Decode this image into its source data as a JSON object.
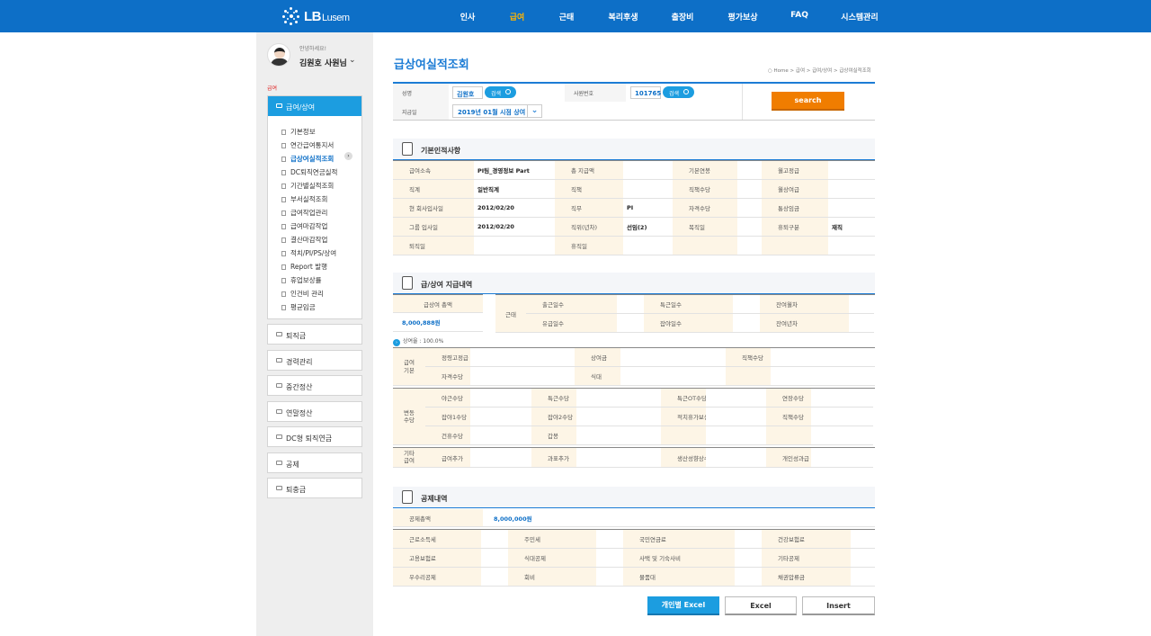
{
  "header": {
    "logo_text": "LB",
    "logo_text_small": "Lusem",
    "nav": [
      "인사",
      "급여",
      "근태",
      "복리후생",
      "출장비",
      "평가보상",
      "FAQ",
      "시스템관리"
    ],
    "nav_active": 1
  },
  "sidebar": {
    "greeting": "안녕하세요!",
    "user": "김원호 사원님",
    "section": "급여",
    "open_menu": "급여/상여",
    "submenu": [
      "기본정보",
      "연간급여통지서",
      "급상여실적조회",
      "DC퇴직연금실적",
      "기간별실적조회",
      "부서실적조회",
      "급여작업관리",
      "급여마감작업",
      "결산마감작업",
      "적치/PI/PS/상여",
      "Report 발행",
      "휴업보상률",
      "인건비 관리",
      "평균임금"
    ],
    "submenu_active": 2,
    "closed_menus": [
      "퇴직금",
      "경력관리",
      "중간정산",
      "연말정산",
      "DC형 퇴직연금",
      "공제",
      "퇴충금"
    ]
  },
  "page": {
    "title": "급상여실적조회",
    "breadcrumb": "○ Home > 급여 > 급여/상여 > 급상여실적조회"
  },
  "search": {
    "name_label": "성명",
    "name_value": "김원호",
    "name_btn": "검색",
    "empno_label": "사원번호",
    "empno_value": "101765",
    "empno_btn": "검색",
    "paydate_label": "지급일",
    "paydate_value": "2019년 01월 시점 상여",
    "search_btn": "search"
  },
  "basic": {
    "title": "기본인적사항",
    "rows": [
      [
        "급여소속",
        "PI팀_경영정보 Part",
        "총 지급액",
        "",
        "기본연봉",
        "",
        "월고정급",
        ""
      ],
      [
        "직계",
        "일반직계",
        "직책",
        "",
        "직책수당",
        "",
        "월상여급",
        ""
      ],
      [
        "현 회사입사일",
        "2012/02/20",
        "직무",
        "PI",
        "자격수당",
        "",
        "통상임금",
        ""
      ],
      [
        "그룹 입사일",
        "2012/02/20",
        "직위(년차)",
        "선임(2)",
        "복직일",
        "",
        "휴퇴구분",
        "재직"
      ],
      [
        "퇴직일",
        "",
        "휴직일",
        "",
        "",
        "",
        "",
        ""
      ]
    ]
  },
  "pay": {
    "title": "급/상여 지급내역",
    "total_label": "급상여 총액",
    "total_value": "8,000,888원",
    "attend_label": "근태",
    "attend_rows": [
      [
        "출근일수",
        "",
        "특근일수",
        "",
        "잔여월차",
        ""
      ],
      [
        "유급일수",
        "",
        "잡야일수",
        "",
        "잔여년차",
        ""
      ]
    ],
    "rate_label": "상여율 : 100.0%",
    "base_label": "급여\n기본",
    "base_rows": [
      [
        "정령고정급",
        "",
        "상여금",
        "",
        "직책수당",
        ""
      ],
      [
        "자격수당",
        "",
        "식대",
        "",
        "",
        ""
      ]
    ],
    "var_label": "변동\n수당",
    "var_rows": [
      [
        "야근수당",
        "",
        "특근수당",
        "",
        "특근OT수당",
        "",
        "연장수당",
        ""
      ],
      [
        "잡야1수당",
        "",
        "잡야2수당",
        "",
        "적치휴가보상수당",
        "",
        "직책수당",
        ""
      ],
      [
        "건휴수당",
        "",
        "갑봉",
        "",
        "",
        "",
        "",
        ""
      ]
    ],
    "etc_label": "기타\n급여",
    "etc_row": [
      "급여추가",
      "",
      "과표추가",
      "",
      "생산성향상수당(月)",
      "",
      "개인성과급",
      ""
    ]
  },
  "deduct": {
    "title": "공제내역",
    "total_label": "공제총액",
    "total_value": "8,000,000원",
    "rows": [
      [
        "근로소득세",
        "",
        "주민세",
        "",
        "국민연금료",
        "",
        "건강보험료",
        ""
      ],
      [
        "고용보험료",
        "",
        "식대공제",
        "",
        "사택 및 기숙사비",
        "",
        "기타공제",
        ""
      ],
      [
        "우수리공제",
        "",
        "회비",
        "",
        "물품대",
        "",
        "채권압류금",
        ""
      ]
    ]
  },
  "buttons": {
    "personal_excel": "개인별 Excel",
    "excel": "Excel",
    "insert": "Insert"
  },
  "colors": {
    "brand": "#0d6fc7",
    "accent": "#1c9de0",
    "active_nav": "#ffb400",
    "search_btn": "#f07d00",
    "label_bg": "#fdf5e6"
  }
}
